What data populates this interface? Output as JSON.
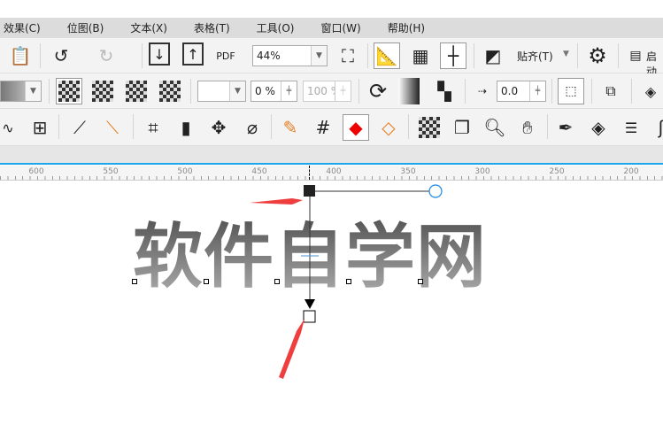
{
  "menu": [
    "效果(C)",
    "位图(B)",
    "文本(X)",
    "表格(T)",
    "工具(O)",
    "窗口(W)",
    "帮助(H)"
  ],
  "toolbar1": {
    "zoom": "44%",
    "snap": "贴齐(T)",
    "launch": "启动",
    "pdf": "PDF"
  },
  "toolbar2": {
    "opacity_start": "0 %",
    "opacity_end": "100 %",
    "offset": "0.0"
  },
  "ruler": [
    "600",
    "550",
    "500",
    "450",
    "400",
    "350",
    "300",
    "250",
    "200"
  ],
  "canvas": {
    "text": "软件自学网"
  },
  "colors": {
    "accent": "#1ea7e8",
    "arrow": "#ef3e3e",
    "handle": "#1e88e5"
  }
}
